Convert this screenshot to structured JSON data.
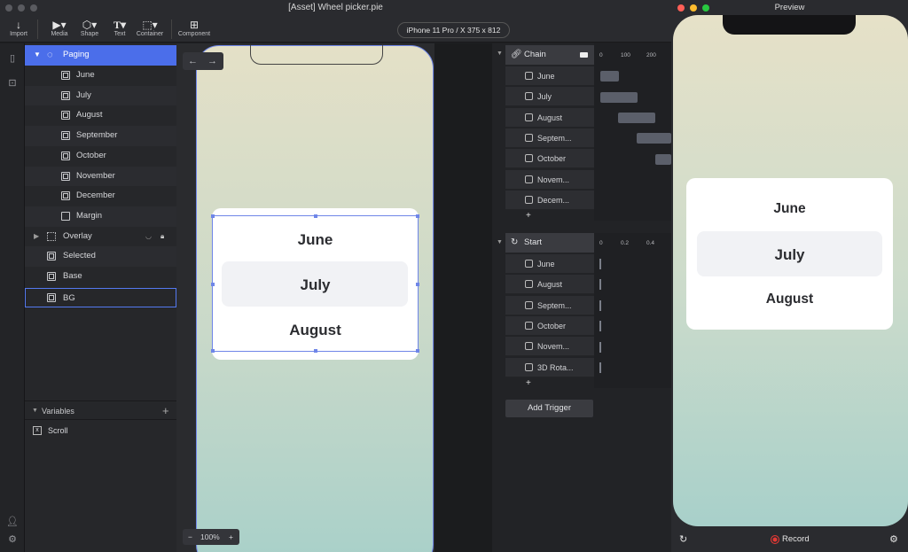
{
  "main_window": {
    "title": "[Asset] Wheel picker.pie"
  },
  "toolbar": {
    "import": "Import",
    "media": "Media",
    "shape": "Shape",
    "text": "Text",
    "container": "Container",
    "component": "Component",
    "device": "iPhone 11 Pro / X  375 x 812"
  },
  "layers": {
    "items": [
      {
        "label": "Paging"
      },
      {
        "label": "June"
      },
      {
        "label": "July"
      },
      {
        "label": "August"
      },
      {
        "label": "September"
      },
      {
        "label": "October"
      },
      {
        "label": "November"
      },
      {
        "label": "December"
      },
      {
        "label": "Margin"
      },
      {
        "label": "Overlay"
      },
      {
        "label": "Selected"
      },
      {
        "label": "Base"
      },
      {
        "label": "BG"
      }
    ]
  },
  "variables": {
    "title": "Variables",
    "items": [
      {
        "label": "Scroll"
      }
    ]
  },
  "canvas": {
    "picker_items": [
      "June",
      "July",
      "August"
    ],
    "zoom": "100%"
  },
  "timeline": {
    "chain": {
      "label": "Chain",
      "ticks": [
        "0",
        "100",
        "200"
      ],
      "rows": [
        "June",
        "July",
        "August",
        "Septem...",
        "October",
        "Novem...",
        "Decem..."
      ]
    },
    "start": {
      "label": "Start",
      "ticks": [
        "0",
        "0.2",
        "0.4"
      ],
      "rows": [
        "June",
        "August",
        "Septem...",
        "October",
        "Novem...",
        "3D Rota..."
      ]
    },
    "add_trigger": "Add Trigger"
  },
  "preview": {
    "title": "Preview",
    "picker_items": [
      "June",
      "July",
      "August"
    ],
    "record": "Record"
  },
  "colors": {
    "accent": "#4b6eea",
    "record": "#e53935"
  }
}
